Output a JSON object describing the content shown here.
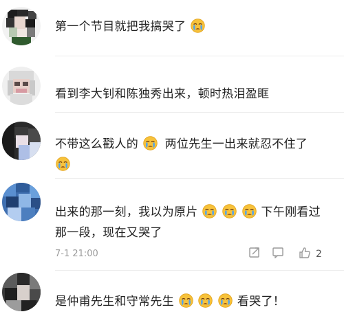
{
  "comments": [
    {
      "text_parts": [
        "第一个节目就把我搞哭了"
      ],
      "emoji": "crying-face"
    },
    {
      "text_parts": [
        "看到李大钊和陈独秀出来，顿时热泪盈眶"
      ]
    },
    {
      "line1_a": "不带这么戳人的",
      "line1_b": "两位先生一出来就忍不住了",
      "emoji": "crying-face"
    },
    {
      "line1_a": "出来的那一刻，我以为原片",
      "line1_b": "下午刚看过",
      "line2": "那一段，现在又哭了",
      "time": "7-1 21:00",
      "like_count": "2",
      "emoji": "crying-face"
    },
    {
      "line1_a": "是仲甫先生和守常先生",
      "line1_b": "看哭了！",
      "emoji": "crying-face"
    }
  ],
  "icons": {
    "share": "share-icon",
    "comment": "comment-icon",
    "like": "thumbs-up-icon"
  },
  "colors": {
    "text": "#222222",
    "meta": "#9a9a9a",
    "divider": "#ececec",
    "emoji_face": "#f7c23b",
    "emoji_tear": "#4fa3f0"
  }
}
